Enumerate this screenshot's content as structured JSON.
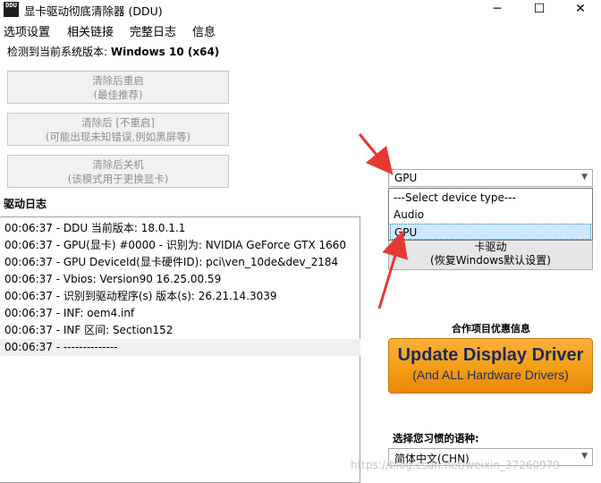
{
  "window": {
    "title": "显卡驱动彻底清除器 (DDU)",
    "app_icon_text": "DDU",
    "minimize": "─",
    "maximize": "☐",
    "close": "✕"
  },
  "menu": [
    "选项设置",
    "相关链接",
    "完整日志",
    "信息"
  ],
  "detected": {
    "label": "检测到当前系统版本: ",
    "value": "Windows 10 (x64)"
  },
  "actions": [
    {
      "line1": "清除后重启",
      "line2": "(最佳推荐)"
    },
    {
      "line1": "清除后 [不重启]",
      "line2": "(可能出现未知错误,例如黑屏等)"
    },
    {
      "line1": "清除后关机",
      "line2": "(该模式用于更换显卡)"
    }
  ],
  "log_title": "驱动日志",
  "log": [
    "00:06:37 - DDU 当前版本: 18.0.1.1",
    "00:06:37 - GPU(显卡) #0000 - 识别为: NVIDIA GeForce GTX 1660",
    "00:06:37 - GPU DeviceId(显卡硬件ID): pci\\ven_10de&dev_2184",
    "00:06:37 - Vbios: Version90 16.25.00.59",
    "00:06:37 - 识别到驱动程序(s) 版本(s): 26.21.14.3039",
    "00:06:37 - INF: oem4.inf",
    "00:06:37 - INF 区间: Section152",
    "00:06:37 - --------------"
  ],
  "device_type": {
    "selected": "GPU",
    "options": [
      "---Select device type---",
      "Audio",
      "GPU"
    ],
    "highlighted_index": 2
  },
  "reset_button": {
    "line1": "卡驱动",
    "line2": "(恢复Windows默认设置)"
  },
  "ad": {
    "label": "合作项目优惠信息",
    "line1": "Update Display Driver",
    "line2": "(And ALL Hardware Drivers)"
  },
  "language": {
    "label": "选择您习惯的语种:",
    "selected": "简体中文(CHN)"
  },
  "watermark": "https://blog.csdn.net/weixin_37260979",
  "colors": {
    "annotation_arrow": "#e53935",
    "ad_orange": "#f39c12",
    "ad_text": "#1c2b57",
    "highlight": "#cce8ff"
  }
}
